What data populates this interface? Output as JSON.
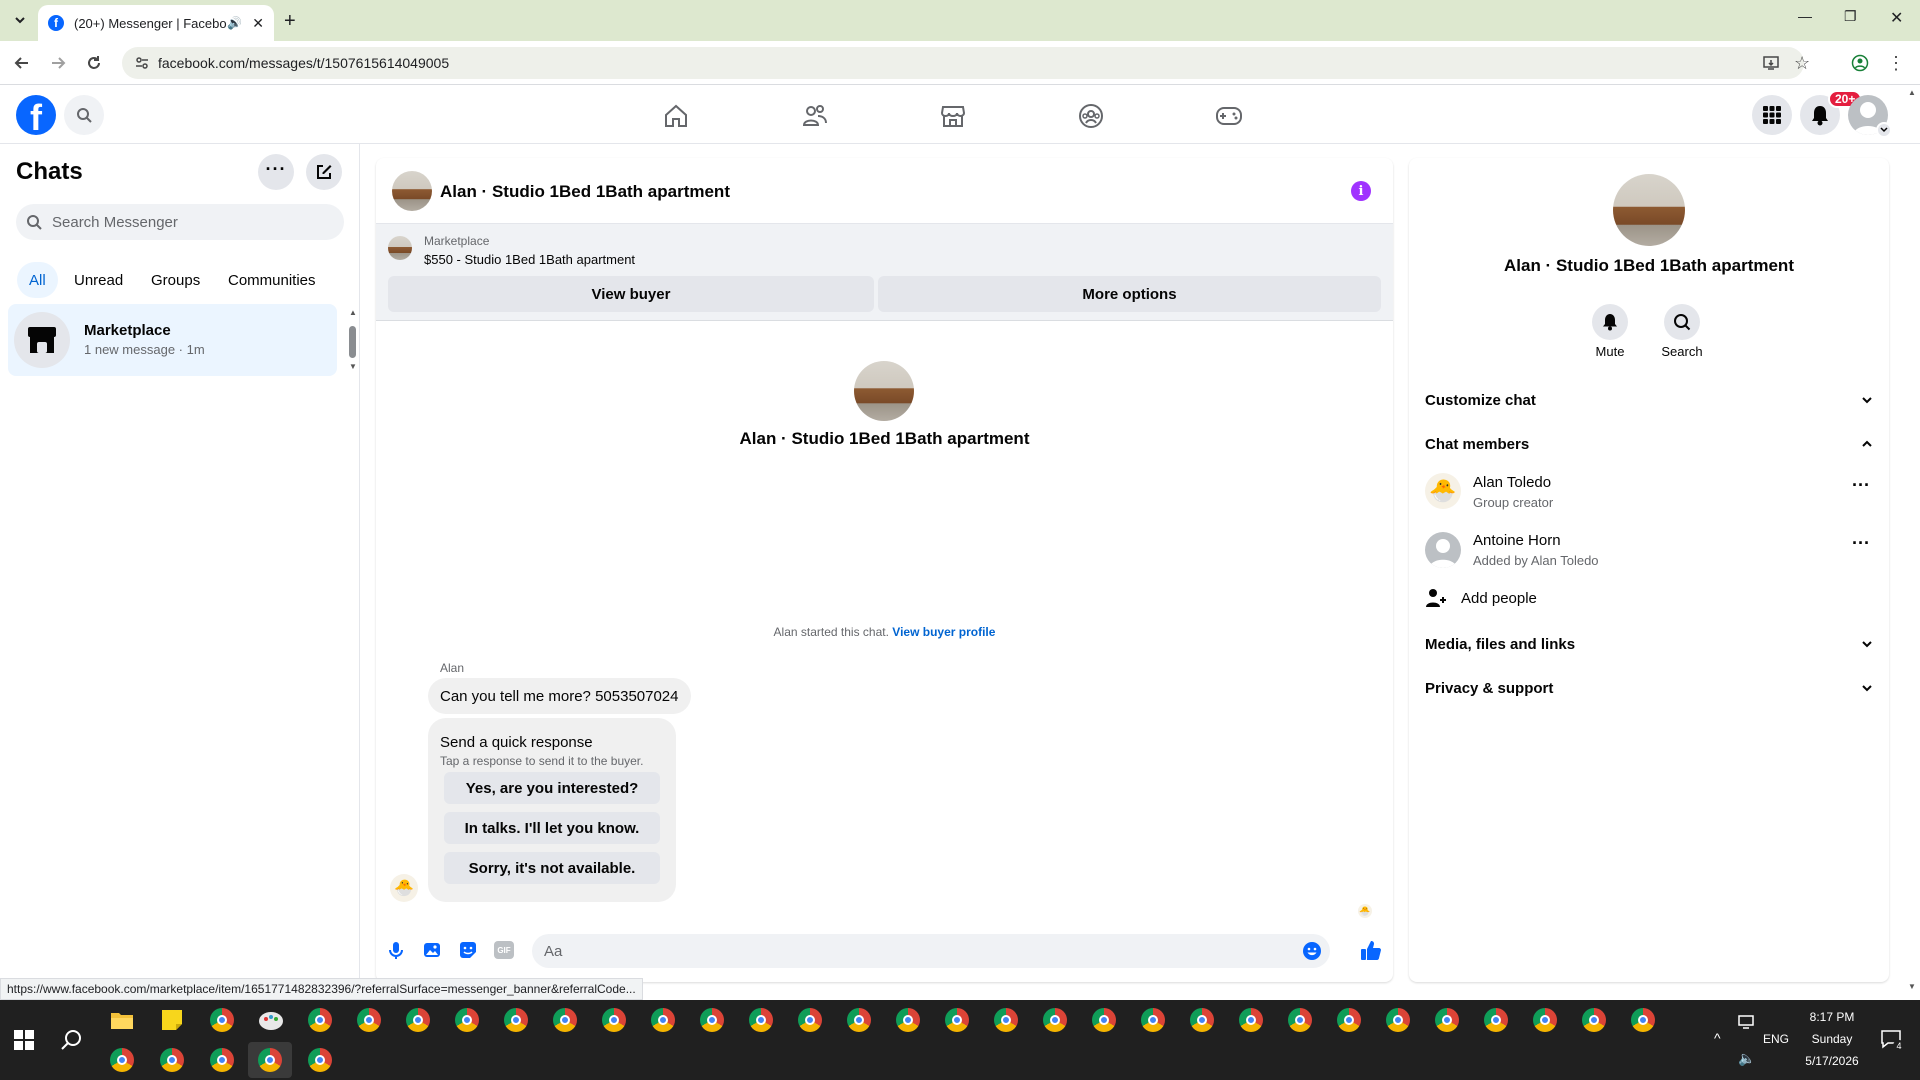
{
  "browser": {
    "tab_title": "(20+) Messenger | Faceboo",
    "url": "facebook.com/messages/t/1507615614049005",
    "status_url": "https://www.facebook.com/marketplace/item/1651771482832396/?referralSurface=messenger_banner&referralCode..."
  },
  "header": {
    "notif_badge": "20+"
  },
  "left": {
    "title": "Chats",
    "search_placeholder": "Search Messenger",
    "filters": [
      "All",
      "Unread",
      "Groups",
      "Communities"
    ],
    "chat": {
      "name": "Marketplace",
      "preview": "1 new message · 1m"
    }
  },
  "conversation": {
    "title": "Alan · Studio 1Bed 1Bath apartment",
    "banner": {
      "label": "Marketplace",
      "listing": "$550 - Studio 1Bed 1Bath apartment",
      "view_buyer": "View buyer",
      "more_options": "More options"
    },
    "intro_name": "Alan · Studio 1Bed 1Bath apartment",
    "started_text": "Alan started this chat.",
    "view_profile": "View buyer profile",
    "sender": "Alan",
    "message": "Can you tell me more? 5053507024",
    "quick": {
      "title": "Send a quick response",
      "subtitle": "Tap a response to send it to the buyer.",
      "options": [
        "Yes, are you interested?",
        "In talks. I'll let you know.",
        "Sorry, it's not available."
      ]
    },
    "composer_placeholder": "Aa"
  },
  "details": {
    "name": "Alan · Studio 1Bed 1Bath apartment",
    "mute": "Mute",
    "search": "Search",
    "customize": "Customize chat",
    "members_title": "Chat members",
    "members": [
      {
        "name": "Alan Toledo",
        "role": "Group creator"
      },
      {
        "name": "Antoine Horn",
        "role": "Added by Alan Toledo"
      }
    ],
    "add_people": "Add people",
    "media": "Media, files and links",
    "privacy": "Privacy & support"
  },
  "taskbar": {
    "time": "8:17 PM",
    "day": "Sunday",
    "date": "5/17/2026",
    "lang": "ENG",
    "notif_count": "4"
  },
  "colors": {
    "fb_blue": "#0866ff",
    "accent_purple": "#a033ff",
    "link_blue": "#0064d1"
  }
}
